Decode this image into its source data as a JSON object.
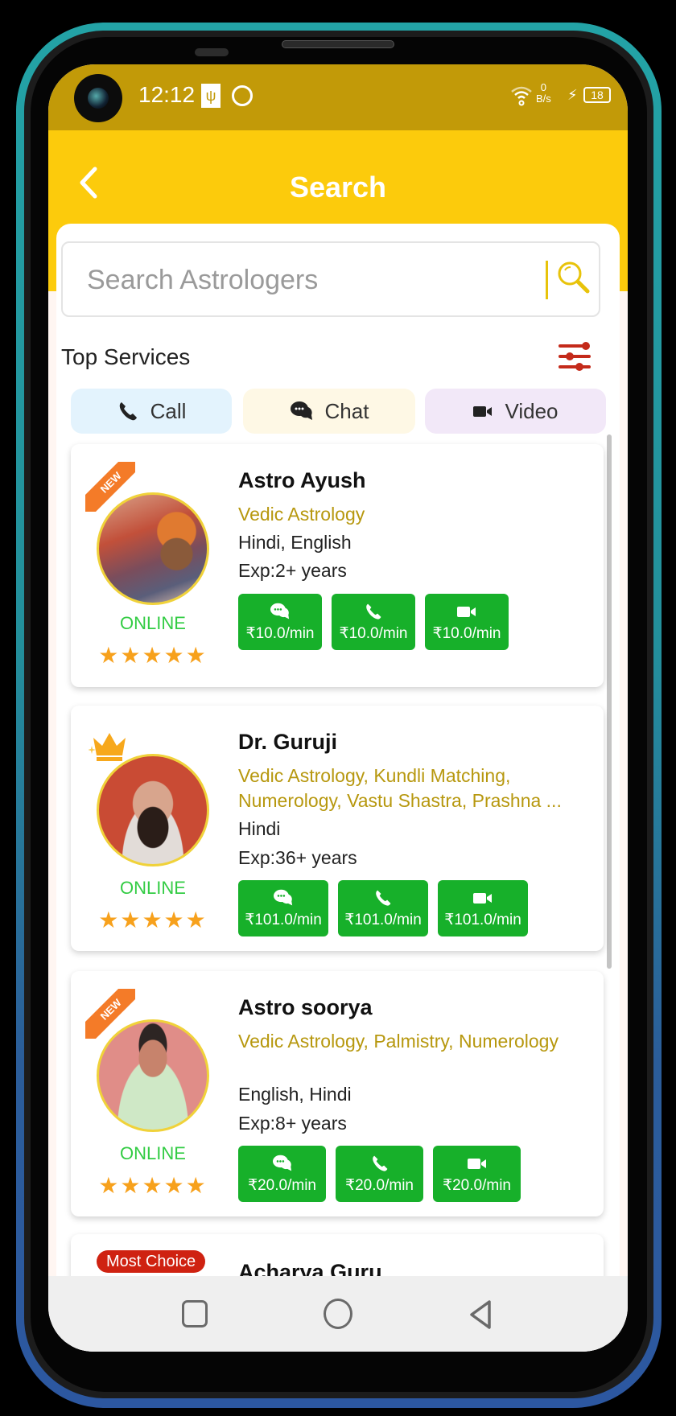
{
  "status_bar": {
    "time": "12:12",
    "net_speed_value": "0",
    "net_speed_unit": "B/s",
    "battery": "18",
    "icons": [
      "usb-icon",
      "sync-icon",
      "wifi-icon",
      "charging-bolt-icon",
      "battery-icon"
    ]
  },
  "header": {
    "title": "Search",
    "back_icon": "chevron-left-icon"
  },
  "search": {
    "placeholder": "Search Astrologers",
    "value": ""
  },
  "top_services": {
    "title": "Top Services",
    "filter_icon": "sliders-icon",
    "chips": [
      {
        "label": "Call",
        "icon": "phone-icon",
        "color": "#e3f3fd"
      },
      {
        "label": "Chat",
        "icon": "chat-icon",
        "color": "#fef8e5"
      },
      {
        "label": "Video",
        "icon": "video-icon",
        "color": "#f2e8f8"
      }
    ]
  },
  "colors": {
    "header_yellow": "#fccb0c",
    "status_bar": "#c29a08",
    "price_green": "#17b02a",
    "online_green": "#33cc44",
    "skills_gold": "#b7980f",
    "star_orange": "#f7a11c",
    "new_ribbon": "#f47b28",
    "most_choice_red": "#cf2211"
  },
  "astrologers": [
    {
      "badge": "NEW",
      "name": "Astro Ayush",
      "skills": "Vedic Astrology",
      "languages": "Hindi, English",
      "experience": "Exp:2+ years",
      "status": "ONLINE",
      "rating": 5,
      "stars": "★★★★★",
      "prices": {
        "chat": "₹10.0/min",
        "call": "₹10.0/min",
        "video": "₹10.0/min"
      }
    },
    {
      "badge": "crown",
      "name": "Dr. Guruji",
      "skills": "Vedic Astrology, Kundli Matching, Numerology, Vastu Shastra, Prashna ...",
      "languages": "Hindi",
      "experience": "Exp:36+ years",
      "status": "ONLINE",
      "rating": 5,
      "stars": "★★★★★",
      "prices": {
        "chat": "₹101.0/min",
        "call": "₹101.0/min",
        "video": "₹101.0/min"
      }
    },
    {
      "badge": "NEW",
      "name": "Astro soorya",
      "skills": "Vedic Astrology, Palmistry, Numerology",
      "languages": "English, Hindi",
      "experience": "Exp:8+ years",
      "status": "ONLINE",
      "rating": 5,
      "stars": "★★★★★",
      "prices": {
        "chat": "₹20.0/min",
        "call": "₹20.0/min",
        "video": "₹20.0/min"
      }
    },
    {
      "badge": "Most Choice",
      "name": "Acharya Guru"
    }
  ],
  "nav_bar": {
    "buttons": [
      "recents-button",
      "home-button",
      "back-button"
    ]
  }
}
